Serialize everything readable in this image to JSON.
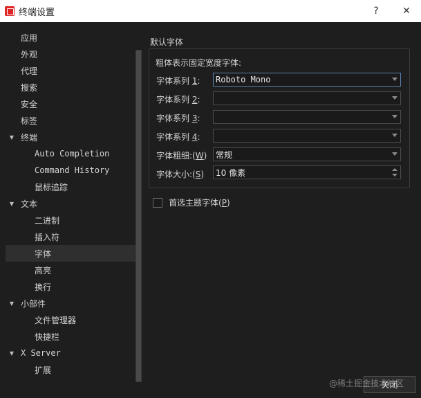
{
  "window": {
    "title": "终端设置",
    "help_glyph": "?",
    "close_glyph": "✕"
  },
  "sidebar": {
    "items": [
      {
        "label": "应用",
        "level": 1,
        "arrow": ""
      },
      {
        "label": "外观",
        "level": 1,
        "arrow": ""
      },
      {
        "label": "代理",
        "level": 1,
        "arrow": ""
      },
      {
        "label": "搜索",
        "level": 1,
        "arrow": ""
      },
      {
        "label": "安全",
        "level": 1,
        "arrow": ""
      },
      {
        "label": "标签",
        "level": 1,
        "arrow": ""
      },
      {
        "label": "终端",
        "level": 1,
        "arrow": "▼"
      },
      {
        "label": "Auto Completion",
        "level": 2,
        "arrow": ""
      },
      {
        "label": "Command History",
        "level": 2,
        "arrow": ""
      },
      {
        "label": "鼠标追踪",
        "level": 2,
        "arrow": ""
      },
      {
        "label": "文本",
        "level": 1,
        "arrow": "▼"
      },
      {
        "label": "二进制",
        "level": 2,
        "arrow": ""
      },
      {
        "label": "插入符",
        "level": 2,
        "arrow": ""
      },
      {
        "label": "字体",
        "level": 2,
        "arrow": "",
        "selected": true
      },
      {
        "label": "高亮",
        "level": 2,
        "arrow": ""
      },
      {
        "label": "换行",
        "level": 2,
        "arrow": ""
      },
      {
        "label": "小部件",
        "level": 1,
        "arrow": "▼"
      },
      {
        "label": "文件管理器",
        "level": 2,
        "arrow": ""
      },
      {
        "label": "快捷栏",
        "level": 2,
        "arrow": ""
      },
      {
        "label": "X Server",
        "level": 1,
        "arrow": "▼"
      },
      {
        "label": "扩展",
        "level": 2,
        "arrow": ""
      }
    ]
  },
  "main": {
    "group_title": "默认字体",
    "subtitle": "粗体表示固定宽度字体:",
    "fields": {
      "family1": {
        "pre": "字体系列 ",
        "key": "1",
        "post": ":",
        "value": "Roboto Mono"
      },
      "family2": {
        "pre": "字体系列 ",
        "key": "2",
        "post": ":",
        "value": ""
      },
      "family3": {
        "pre": "字体系列 ",
        "key": "3",
        "post": ":",
        "value": ""
      },
      "family4": {
        "pre": "字体系列 ",
        "key": "4",
        "post": ":",
        "value": ""
      },
      "weight": {
        "pre": "字体粗细:(",
        "key": "W",
        "post": ")",
        "value": "常规"
      },
      "size": {
        "pre": "字体大小:(",
        "key": "S",
        "post": ")",
        "value": "10 像素"
      }
    },
    "theme_font": {
      "pre": "首选主题字体(",
      "key": "P",
      "post": ")",
      "checked": false
    }
  },
  "footer": {
    "ok_label": "关闭",
    "watermark": "@稀土掘金技术社区"
  }
}
